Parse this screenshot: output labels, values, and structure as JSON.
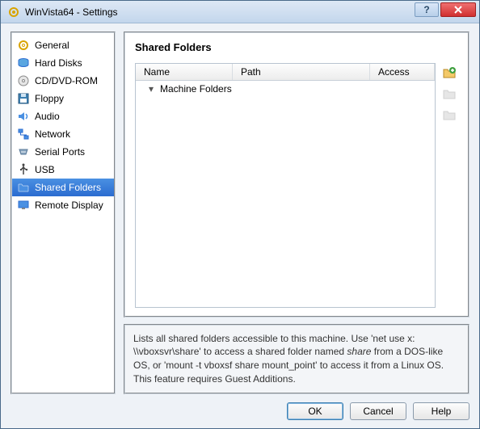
{
  "window": {
    "title": "WinVista64 - Settings"
  },
  "sidebar": {
    "items": [
      {
        "label": "General",
        "icon": "gear-icon"
      },
      {
        "label": "Hard Disks",
        "icon": "harddisk-icon"
      },
      {
        "label": "CD/DVD-ROM",
        "icon": "disc-icon"
      },
      {
        "label": "Floppy",
        "icon": "floppy-icon"
      },
      {
        "label": "Audio",
        "icon": "audio-icon"
      },
      {
        "label": "Network",
        "icon": "network-icon"
      },
      {
        "label": "Serial Ports",
        "icon": "serial-icon"
      },
      {
        "label": "USB",
        "icon": "usb-icon"
      },
      {
        "label": "Shared Folders",
        "icon": "folder-icon"
      },
      {
        "label": "Remote Display",
        "icon": "display-icon"
      }
    ],
    "selected_index": 8
  },
  "main": {
    "page_title": "Shared Folders",
    "columns": {
      "name": "Name",
      "path": "Path",
      "access": "Access"
    },
    "tree": {
      "root_label": "Machine Folders"
    },
    "hint_prefix": "Lists all shared folders accessible to this machine. Use 'net use x: \\\\vboxsvr\\share' to access a shared folder named ",
    "hint_share": "share",
    "hint_suffix": " from a DOS-like OS, or 'mount -t vboxsf share mount_point' to access it from a Linux OS. This feature requires Guest Additions."
  },
  "buttons": {
    "ok": "OK",
    "cancel": "Cancel",
    "help": "Help"
  }
}
